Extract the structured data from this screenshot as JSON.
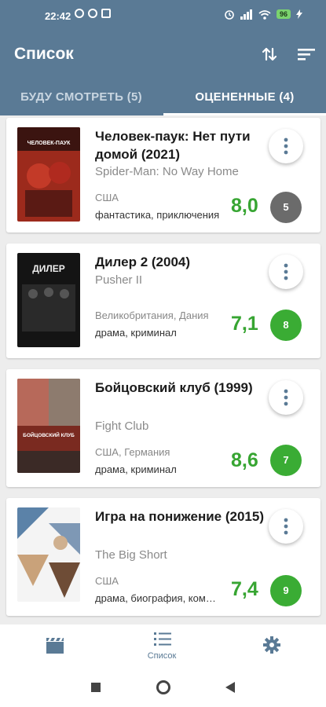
{
  "status_bar": {
    "time": "22:42",
    "battery": "96"
  },
  "app_bar": {
    "title": "Список"
  },
  "tabs": [
    {
      "label": "БУДУ СМОТРЕТЬ (5)",
      "selected": false
    },
    {
      "label": "ОЦЕНЕННЫЕ (4)",
      "selected": true
    }
  ],
  "movies": [
    {
      "title": "Человек-паук: Нет пути домой (2021)",
      "original": "Spider-Man: No Way Home",
      "country": "США",
      "genres": "фантастика, приключения",
      "rating": "8,0",
      "my_score": "5",
      "badge_color": "#6b6b6b",
      "poster_text": "ЧЕЛОВЕК-ПАУК"
    },
    {
      "title": "Дилер 2 (2004)",
      "original": "Pusher II",
      "country": "Великобритания, Дания",
      "genres": "драма, криминал",
      "rating": "7,1",
      "my_score": "8",
      "badge_color": "#3aac34",
      "poster_text": "ДИЛЕР"
    },
    {
      "title": "Бойцовский клуб (1999)",
      "original": "Fight Club",
      "country": "США, Германия",
      "genres": "драма, криминал",
      "rating": "8,6",
      "my_score": "7",
      "badge_color": "#3aac34",
      "poster_text": "БОЙЦОВСКИЙ КЛУБ"
    },
    {
      "title": "Игра на понижение (2015)",
      "original": "The Big Short",
      "country": "США",
      "genres": "драма, биография, комедия",
      "rating": "7,4",
      "my_score": "9",
      "badge_color": "#3aac34",
      "poster_text": ""
    }
  ],
  "bottom_nav": [
    {
      "icon": "movie-clapper-icon",
      "label": ""
    },
    {
      "icon": "list-icon",
      "label": "Список",
      "selected": true
    },
    {
      "icon": "gear-icon",
      "label": ""
    }
  ],
  "colors": {
    "primary": "#5a7a95",
    "rating_green": "#37a532"
  }
}
